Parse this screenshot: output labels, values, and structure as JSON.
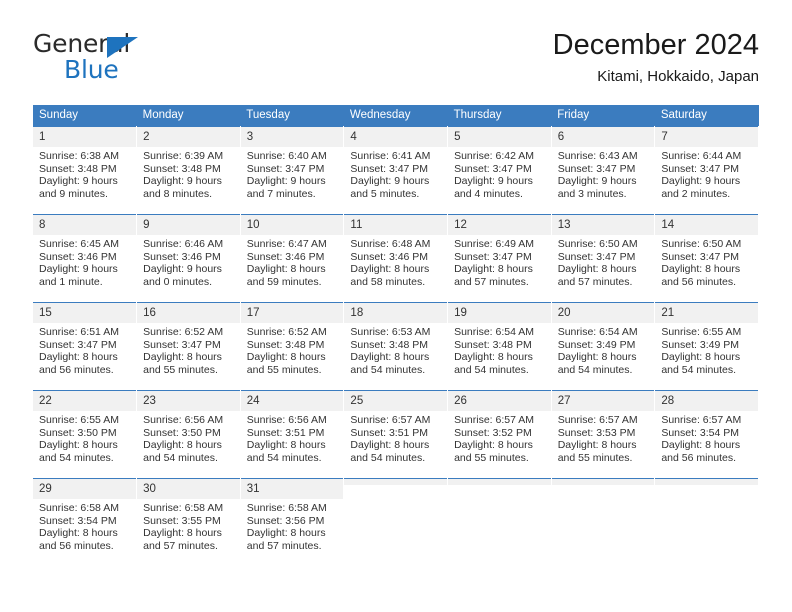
{
  "brand": {
    "word1": "General",
    "word2": "Blue",
    "triangle_color": "#1e73be"
  },
  "header": {
    "title": "December 2024",
    "subtitle": "Kitami, Hokkaido, Japan",
    "accent_color": "#3b7cbf",
    "daynum_bg": "#f1f1f1"
  },
  "weekday_headers": [
    "Sunday",
    "Monday",
    "Tuesday",
    "Wednesday",
    "Thursday",
    "Friday",
    "Saturday"
  ],
  "labels": {
    "sunrise_prefix": "Sunrise:",
    "sunset_prefix": "Sunset:",
    "daylight_prefix": "Daylight:"
  },
  "weeks": [
    [
      {
        "day": "1",
        "sunrise": "Sunrise: 6:38 AM",
        "sunset": "Sunset: 3:48 PM",
        "daylight_1": "Daylight: 9 hours",
        "daylight_2": "and 9 minutes."
      },
      {
        "day": "2",
        "sunrise": "Sunrise: 6:39 AM",
        "sunset": "Sunset: 3:48 PM",
        "daylight_1": "Daylight: 9 hours",
        "daylight_2": "and 8 minutes."
      },
      {
        "day": "3",
        "sunrise": "Sunrise: 6:40 AM",
        "sunset": "Sunset: 3:47 PM",
        "daylight_1": "Daylight: 9 hours",
        "daylight_2": "and 7 minutes."
      },
      {
        "day": "4",
        "sunrise": "Sunrise: 6:41 AM",
        "sunset": "Sunset: 3:47 PM",
        "daylight_1": "Daylight: 9 hours",
        "daylight_2": "and 5 minutes."
      },
      {
        "day": "5",
        "sunrise": "Sunrise: 6:42 AM",
        "sunset": "Sunset: 3:47 PM",
        "daylight_1": "Daylight: 9 hours",
        "daylight_2": "and 4 minutes."
      },
      {
        "day": "6",
        "sunrise": "Sunrise: 6:43 AM",
        "sunset": "Sunset: 3:47 PM",
        "daylight_1": "Daylight: 9 hours",
        "daylight_2": "and 3 minutes."
      },
      {
        "day": "7",
        "sunrise": "Sunrise: 6:44 AM",
        "sunset": "Sunset: 3:47 PM",
        "daylight_1": "Daylight: 9 hours",
        "daylight_2": "and 2 minutes."
      }
    ],
    [
      {
        "day": "8",
        "sunrise": "Sunrise: 6:45 AM",
        "sunset": "Sunset: 3:46 PM",
        "daylight_1": "Daylight: 9 hours",
        "daylight_2": "and 1 minute."
      },
      {
        "day": "9",
        "sunrise": "Sunrise: 6:46 AM",
        "sunset": "Sunset: 3:46 PM",
        "daylight_1": "Daylight: 9 hours",
        "daylight_2": "and 0 minutes."
      },
      {
        "day": "10",
        "sunrise": "Sunrise: 6:47 AM",
        "sunset": "Sunset: 3:46 PM",
        "daylight_1": "Daylight: 8 hours",
        "daylight_2": "and 59 minutes."
      },
      {
        "day": "11",
        "sunrise": "Sunrise: 6:48 AM",
        "sunset": "Sunset: 3:46 PM",
        "daylight_1": "Daylight: 8 hours",
        "daylight_2": "and 58 minutes."
      },
      {
        "day": "12",
        "sunrise": "Sunrise: 6:49 AM",
        "sunset": "Sunset: 3:47 PM",
        "daylight_1": "Daylight: 8 hours",
        "daylight_2": "and 57 minutes."
      },
      {
        "day": "13",
        "sunrise": "Sunrise: 6:50 AM",
        "sunset": "Sunset: 3:47 PM",
        "daylight_1": "Daylight: 8 hours",
        "daylight_2": "and 57 minutes."
      },
      {
        "day": "14",
        "sunrise": "Sunrise: 6:50 AM",
        "sunset": "Sunset: 3:47 PM",
        "daylight_1": "Daylight: 8 hours",
        "daylight_2": "and 56 minutes."
      }
    ],
    [
      {
        "day": "15",
        "sunrise": "Sunrise: 6:51 AM",
        "sunset": "Sunset: 3:47 PM",
        "daylight_1": "Daylight: 8 hours",
        "daylight_2": "and 56 minutes."
      },
      {
        "day": "16",
        "sunrise": "Sunrise: 6:52 AM",
        "sunset": "Sunset: 3:47 PM",
        "daylight_1": "Daylight: 8 hours",
        "daylight_2": "and 55 minutes."
      },
      {
        "day": "17",
        "sunrise": "Sunrise: 6:52 AM",
        "sunset": "Sunset: 3:48 PM",
        "daylight_1": "Daylight: 8 hours",
        "daylight_2": "and 55 minutes."
      },
      {
        "day": "18",
        "sunrise": "Sunrise: 6:53 AM",
        "sunset": "Sunset: 3:48 PM",
        "daylight_1": "Daylight: 8 hours",
        "daylight_2": "and 54 minutes."
      },
      {
        "day": "19",
        "sunrise": "Sunrise: 6:54 AM",
        "sunset": "Sunset: 3:48 PM",
        "daylight_1": "Daylight: 8 hours",
        "daylight_2": "and 54 minutes."
      },
      {
        "day": "20",
        "sunrise": "Sunrise: 6:54 AM",
        "sunset": "Sunset: 3:49 PM",
        "daylight_1": "Daylight: 8 hours",
        "daylight_2": "and 54 minutes."
      },
      {
        "day": "21",
        "sunrise": "Sunrise: 6:55 AM",
        "sunset": "Sunset: 3:49 PM",
        "daylight_1": "Daylight: 8 hours",
        "daylight_2": "and 54 minutes."
      }
    ],
    [
      {
        "day": "22",
        "sunrise": "Sunrise: 6:55 AM",
        "sunset": "Sunset: 3:50 PM",
        "daylight_1": "Daylight: 8 hours",
        "daylight_2": "and 54 minutes."
      },
      {
        "day": "23",
        "sunrise": "Sunrise: 6:56 AM",
        "sunset": "Sunset: 3:50 PM",
        "daylight_1": "Daylight: 8 hours",
        "daylight_2": "and 54 minutes."
      },
      {
        "day": "24",
        "sunrise": "Sunrise: 6:56 AM",
        "sunset": "Sunset: 3:51 PM",
        "daylight_1": "Daylight: 8 hours",
        "daylight_2": "and 54 minutes."
      },
      {
        "day": "25",
        "sunrise": "Sunrise: 6:57 AM",
        "sunset": "Sunset: 3:51 PM",
        "daylight_1": "Daylight: 8 hours",
        "daylight_2": "and 54 minutes."
      },
      {
        "day": "26",
        "sunrise": "Sunrise: 6:57 AM",
        "sunset": "Sunset: 3:52 PM",
        "daylight_1": "Daylight: 8 hours",
        "daylight_2": "and 55 minutes."
      },
      {
        "day": "27",
        "sunrise": "Sunrise: 6:57 AM",
        "sunset": "Sunset: 3:53 PM",
        "daylight_1": "Daylight: 8 hours",
        "daylight_2": "and 55 minutes."
      },
      {
        "day": "28",
        "sunrise": "Sunrise: 6:57 AM",
        "sunset": "Sunset: 3:54 PM",
        "daylight_1": "Daylight: 8 hours",
        "daylight_2": "and 56 minutes."
      }
    ],
    [
      {
        "day": "29",
        "sunrise": "Sunrise: 6:58 AM",
        "sunset": "Sunset: 3:54 PM",
        "daylight_1": "Daylight: 8 hours",
        "daylight_2": "and 56 minutes."
      },
      {
        "day": "30",
        "sunrise": "Sunrise: 6:58 AM",
        "sunset": "Sunset: 3:55 PM",
        "daylight_1": "Daylight: 8 hours",
        "daylight_2": "and 57 minutes."
      },
      {
        "day": "31",
        "sunrise": "Sunrise: 6:58 AM",
        "sunset": "Sunset: 3:56 PM",
        "daylight_1": "Daylight: 8 hours",
        "daylight_2": "and 57 minutes."
      },
      {
        "day": "",
        "sunrise": "",
        "sunset": "",
        "daylight_1": "",
        "daylight_2": ""
      },
      {
        "day": "",
        "sunrise": "",
        "sunset": "",
        "daylight_1": "",
        "daylight_2": ""
      },
      {
        "day": "",
        "sunrise": "",
        "sunset": "",
        "daylight_1": "",
        "daylight_2": ""
      },
      {
        "day": "",
        "sunrise": "",
        "sunset": "",
        "daylight_1": "",
        "daylight_2": ""
      }
    ]
  ]
}
